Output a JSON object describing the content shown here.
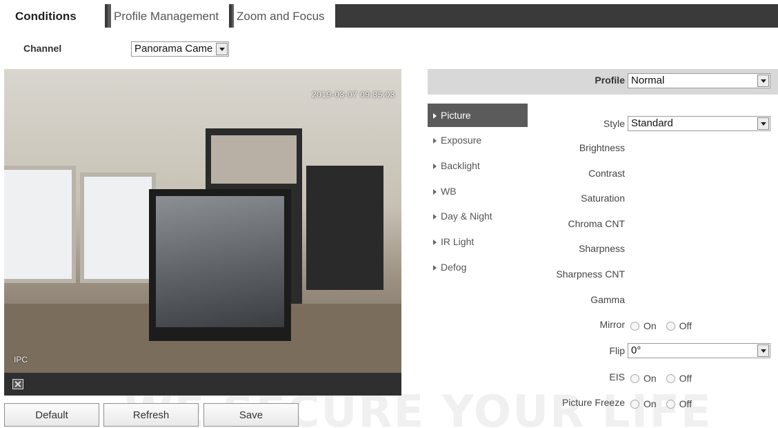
{
  "tabs": [
    {
      "label": "Conditions",
      "active": true
    },
    {
      "label": "Profile Management",
      "active": false
    },
    {
      "label": "Zoom and Focus",
      "active": false
    }
  ],
  "channel": {
    "label": "Channel",
    "value": "Panorama Came"
  },
  "video": {
    "timestamp": "2019-03-07 09:35:03",
    "name": "IPC",
    "fullscreen_icon": "fullscreen-icon"
  },
  "buttons": {
    "default": "Default",
    "refresh": "Refresh",
    "save": "Save"
  },
  "profile": {
    "label": "Profile",
    "value": "Normal"
  },
  "menu": [
    {
      "label": "Picture",
      "active": true
    },
    {
      "label": "Exposure",
      "active": false
    },
    {
      "label": "Backlight",
      "active": false
    },
    {
      "label": "WB",
      "active": false
    },
    {
      "label": "Day & Night",
      "active": false
    },
    {
      "label": "IR Light",
      "active": false
    },
    {
      "label": "Defog",
      "active": false
    }
  ],
  "settings": {
    "style": {
      "label": "Style",
      "value": "Standard"
    },
    "brightness": "Brightness",
    "contrast": "Contrast",
    "saturation": "Saturation",
    "chroma_cnt": "Chroma CNT",
    "sharpness": "Sharpness",
    "sharpness_cnt": "Sharpness CNT",
    "gamma": "Gamma",
    "mirror": {
      "label": "Mirror",
      "on": "On",
      "off": "Off"
    },
    "flip": {
      "label": "Flip",
      "value": "0°"
    },
    "eis": {
      "label": "EIS",
      "on": "On",
      "off": "Off"
    },
    "picture_freeze": {
      "label": "Picture Freeze",
      "on": "On",
      "off": "Off"
    }
  },
  "colors": {
    "tab_bar": "#3a3a3a",
    "menu_active": "#5b5b5b",
    "profile_bar": "#d8d8d8"
  }
}
